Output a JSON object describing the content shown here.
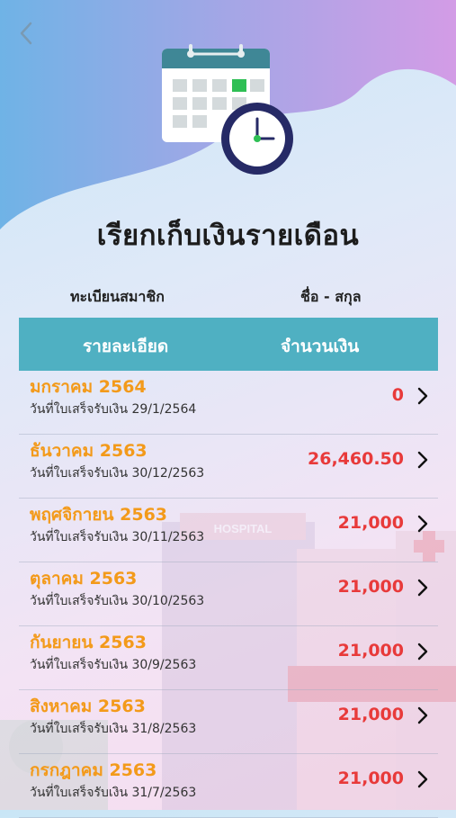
{
  "header": {
    "title": "เรียกเก็บเงินรายเดือน",
    "back_icon": "chevron-left-icon",
    "calendar_icon": "calendar-clock-icon"
  },
  "info": {
    "registration_label": "ทะเบียนสมาชิก",
    "name_label": "ชื่อ - สกุล"
  },
  "table": {
    "col_detail": "รายละเอียด",
    "col_amount": "จำนวนเงิน"
  },
  "background_text": "HOSPITAL",
  "rows": [
    {
      "month": "มกราคม 2564",
      "date": "วันที่ใบเสร็จรับเงิน 29/1/2564",
      "amount": "0"
    },
    {
      "month": "ธันวาคม 2563",
      "date": "วันที่ใบเสร็จรับเงิน 30/12/2563",
      "amount": "26,460.50"
    },
    {
      "month": "พฤศจิกายน 2563",
      "date": "วันที่ใบเสร็จรับเงิน 30/11/2563",
      "amount": "21,000"
    },
    {
      "month": "ตุลาคม 2563",
      "date": "วันที่ใบเสร็จรับเงิน 30/10/2563",
      "amount": "21,000"
    },
    {
      "month": "กันยายน 2563",
      "date": "วันที่ใบเสร็จรับเงิน 30/9/2563",
      "amount": "21,000"
    },
    {
      "month": "สิงหาคม 2563",
      "date": "วันที่ใบเสร็จรับเงิน 31/8/2563",
      "amount": "21,000"
    },
    {
      "month": "กรกฎาคม 2563",
      "date": "วันที่ใบเสร็จรับเงิน 31/7/2563",
      "amount": "21,000"
    }
  ],
  "colors": {
    "header_bar": "#4fb0c2",
    "month_text": "#f39a1a",
    "amount_text": "#e83a3a",
    "calendar_top": "#3f8796",
    "clock_ring": "#262a66"
  }
}
